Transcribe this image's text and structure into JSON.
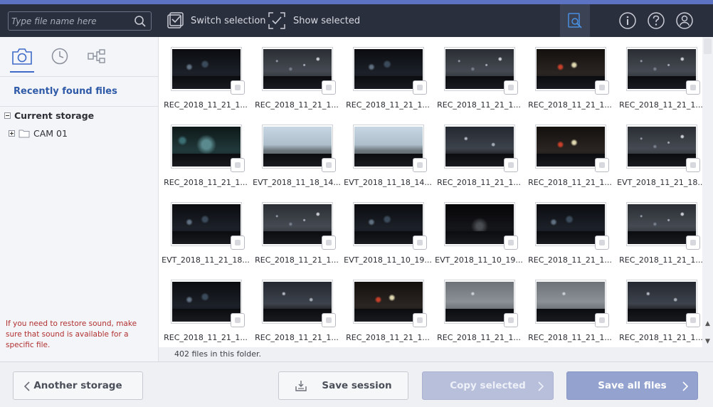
{
  "search": {
    "placeholder": "Type file name here"
  },
  "toolbar": {
    "switch_selection": "Switch selection",
    "show_selected": "Show selected"
  },
  "sidebar": {
    "recent_label": "Recently found files",
    "tree": {
      "root_label": "Current storage",
      "children": [
        "CAM 01"
      ]
    },
    "tip": "If you need to restore sound, make sure that sound is available for a specific file."
  },
  "files": [
    {
      "name": "REC_2018_11_21_1...",
      "scene": "night"
    },
    {
      "name": "REC_2018_11_21_1...",
      "scene": "rain"
    },
    {
      "name": "REC_2018_11_21_1...",
      "scene": "night"
    },
    {
      "name": "REC_2018_11_21_1...",
      "scene": "rain"
    },
    {
      "name": "REC_2018_11_21_1...",
      "scene": "redlights"
    },
    {
      "name": "REC_2018_11_21_1...",
      "scene": "rain"
    },
    {
      "name": "REC_2018_11_21_1...",
      "scene": "tunnel"
    },
    {
      "name": "EVT_2018_11_18_14...",
      "scene": "day"
    },
    {
      "name": "EVT_2018_11_18_14...",
      "scene": "day"
    },
    {
      "name": "REC_2018_11_21_1...",
      "scene": "raindrops"
    },
    {
      "name": "REC_2018_11_21_1...",
      "scene": "redlights"
    },
    {
      "name": "EVT_2018_11_21_18...",
      "scene": "rain"
    },
    {
      "name": "EVT_2018_11_21_18...",
      "scene": "night"
    },
    {
      "name": "REC_2018_11_21_1...",
      "scene": "rain"
    },
    {
      "name": "EVT_2018_11_10_19...",
      "scene": "night"
    },
    {
      "name": "EVT_2018_11_10_19...",
      "scene": "dark"
    },
    {
      "name": "REC_2018_11_21_1...",
      "scene": "night"
    },
    {
      "name": "REC_2018_11_21_1...",
      "scene": "rain"
    },
    {
      "name": "REC_2018_11_21_1...",
      "scene": "night"
    },
    {
      "name": "REC_2018_11_21_1...",
      "scene": "raindrops"
    },
    {
      "name": "REC_2018_11_21_1...",
      "scene": "redlights"
    },
    {
      "name": "REC_2018_11_21_1...",
      "scene": "grey"
    },
    {
      "name": "REC_2018_11_21_1...",
      "scene": "grey"
    },
    {
      "name": "REC_2018_11_21_1...",
      "scene": "raindrops"
    }
  ],
  "status": "402 files in this folder.",
  "actions": {
    "another_storage": "Another storage",
    "save_session": "Save session",
    "copy_selected": "Copy selected",
    "save_all": "Save all files"
  },
  "colors": {
    "accent": "#5c73c4",
    "topbar": "#2a2f3d",
    "link": "#2f5aa8",
    "tip": "#b03030",
    "primary_button": "#94a2cf"
  }
}
